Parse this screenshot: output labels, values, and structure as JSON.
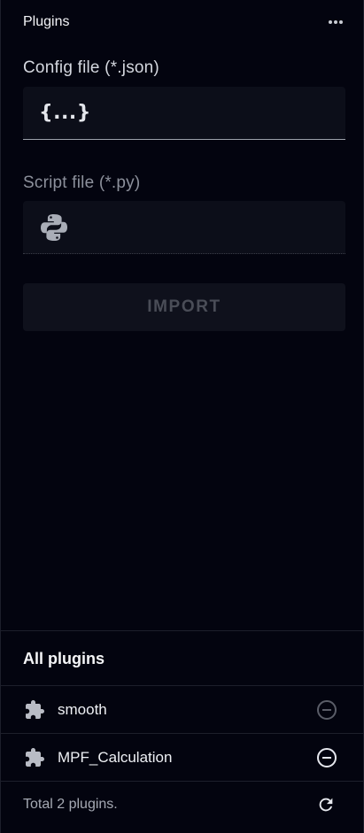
{
  "header": {
    "title": "Plugins",
    "more_icon": "more-horizontal-icon"
  },
  "config_file": {
    "label": "Config file (*.json)",
    "icon_text": "{...}"
  },
  "script_file": {
    "label": "Script file (*.py)",
    "icon": "python-icon"
  },
  "import_button": {
    "label": "IMPORT",
    "enabled": false
  },
  "all_plugins": {
    "title": "All plugins",
    "items": [
      {
        "name": "smooth",
        "icon": "puzzle-icon",
        "action_icon": "remove-circle-icon",
        "action_enabled": false
      },
      {
        "name": "MPF_Calculation",
        "icon": "puzzle-icon",
        "action_icon": "remove-circle-icon",
        "action_enabled": true
      }
    ]
  },
  "footer": {
    "total_text": "Total 2 plugins.",
    "refresh_icon": "refresh-icon"
  },
  "colors": {
    "background": "#03040f",
    "input_bg": "#0c0e19",
    "muted": "#8c909b",
    "disabled": "#4a4d57"
  }
}
